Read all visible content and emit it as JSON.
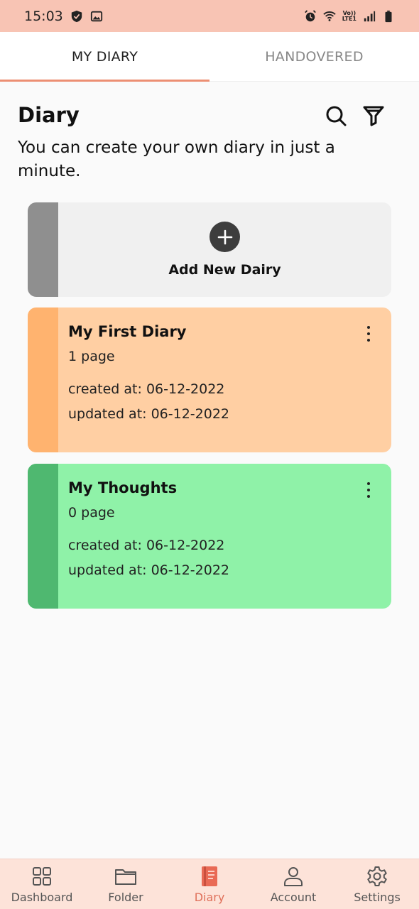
{
  "status_bar": {
    "time": "15:03",
    "network_label_top": "Vo))",
    "network_label_bottom": "LTE1"
  },
  "tabs": [
    {
      "label": "MY DIARY",
      "active": true
    },
    {
      "label": "HANDOVERED",
      "active": false
    }
  ],
  "header": {
    "title": "Diary",
    "subtitle": "You can create your own diary in just a minute."
  },
  "add_card": {
    "label": "Add New Dairy"
  },
  "diaries": [
    {
      "name": "My First Diary",
      "pages": "1 page",
      "created": "created at: 06-12-2022",
      "updated": "updated at: 06-12-2022",
      "color": "#ffcfa3",
      "accent": "#ffb36f"
    },
    {
      "name": "My Thoughts",
      "pages": "0 page",
      "created": "created at: 06-12-2022",
      "updated": "updated at: 06-12-2022",
      "color": "#8ff2a8",
      "accent": "#4fb870"
    }
  ],
  "bottom_nav": [
    {
      "label": "Dashboard",
      "icon": "grid-icon",
      "active": false
    },
    {
      "label": "Folder",
      "icon": "folder-icon",
      "active": false
    },
    {
      "label": "Diary",
      "icon": "diary-icon",
      "active": true
    },
    {
      "label": "Account",
      "icon": "user-icon",
      "active": false
    },
    {
      "label": "Settings",
      "icon": "gear-icon",
      "active": false
    }
  ],
  "colors": {
    "accent": "#ec8f73",
    "status_bar": "#f8c4b4",
    "bottom_nav": "#fde3d9"
  }
}
